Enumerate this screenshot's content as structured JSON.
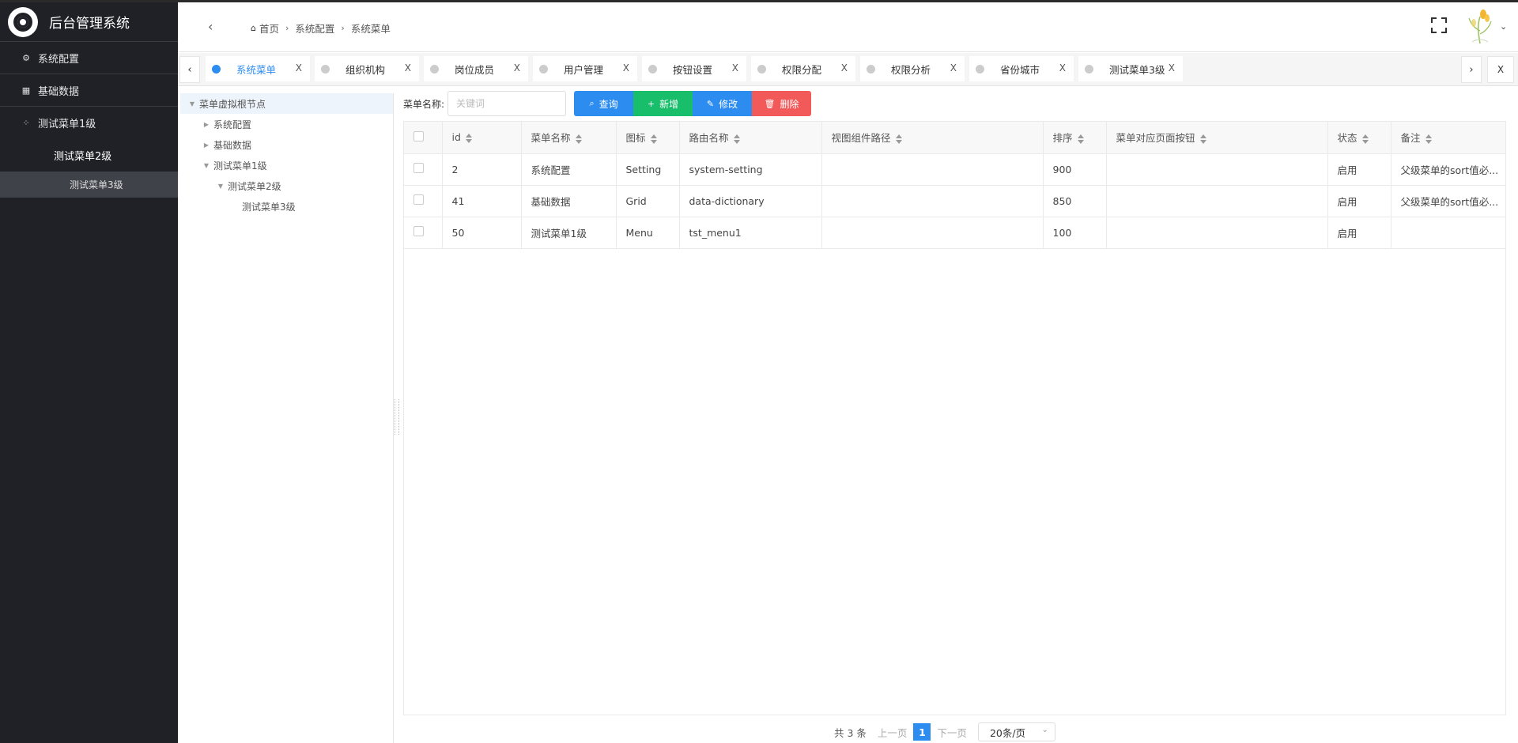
{
  "app": {
    "title": "后台管理系统"
  },
  "sidebar": {
    "items": [
      {
        "label": "系统配置",
        "icon": "gear-icon"
      },
      {
        "label": "基础数据",
        "icon": "grid-icon"
      },
      {
        "label": "测试菜单1级",
        "icon": "apps-icon"
      }
    ],
    "sub_level2": "测试菜单2级",
    "sub_level3": "测试菜单3级"
  },
  "header": {
    "breadcrumb": [
      "首页",
      "系统配置",
      "系统菜单"
    ]
  },
  "tabs": [
    {
      "label": "系统菜单",
      "active": true
    },
    {
      "label": "组织机构",
      "active": false
    },
    {
      "label": "岗位成员",
      "active": false
    },
    {
      "label": "用户管理",
      "active": false
    },
    {
      "label": "按钮设置",
      "active": false
    },
    {
      "label": "权限分配",
      "active": false
    },
    {
      "label": "权限分析",
      "active": false
    },
    {
      "label": "省份城市",
      "active": false
    },
    {
      "label": "测试菜单3级",
      "active": false
    }
  ],
  "tab_close_label": "X",
  "tree": {
    "root": "菜单虚拟根节点",
    "n1": "系统配置",
    "n2": "基础数据",
    "n3": "测试菜单1级",
    "n4": "测试菜单2级",
    "n5": "测试菜单3级"
  },
  "toolbar": {
    "search_label": "菜单名称:",
    "search_placeholder": "关键词",
    "search_value": "",
    "query_label": "查询",
    "add_label": "新增",
    "edit_label": "修改",
    "delete_label": "删除"
  },
  "table": {
    "columns": [
      "id",
      "菜单名称",
      "图标",
      "路由名称",
      "视图组件路径",
      "排序",
      "菜单对应页面按钮",
      "状态",
      "备注"
    ],
    "rows": [
      [
        "2",
        "系统配置",
        "Setting",
        "system-setting",
        "",
        "900",
        "",
        "启用",
        "父级菜单的sort值必..."
      ],
      [
        "41",
        "基础数据",
        "Grid",
        "data-dictionary",
        "",
        "850",
        "",
        "启用",
        "父级菜单的sort值必..."
      ],
      [
        "50",
        "测试菜单1级",
        "Menu",
        "tst_menu1",
        "",
        "100",
        "",
        "启用",
        ""
      ]
    ]
  },
  "pagination": {
    "total": "共 3 条",
    "prev": "上一页",
    "current": "1",
    "next": "下一页",
    "page_size": "20条/页"
  },
  "colors": {
    "sidebar_bg": "#1f2126",
    "primary": "#2d8cf0",
    "success": "#19be6b",
    "danger": "#f25a5a"
  }
}
